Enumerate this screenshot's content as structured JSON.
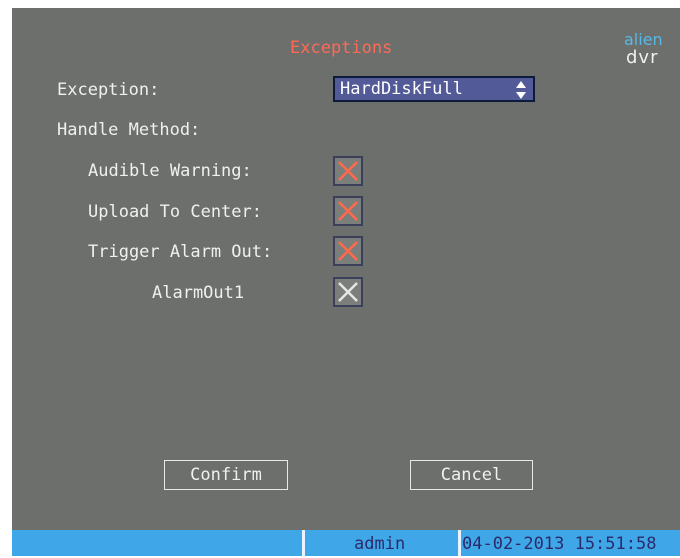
{
  "window": {
    "title": "Exceptions",
    "logo_top": "alien",
    "logo_bottom": "dvr"
  },
  "form": {
    "exception_label": "Exception:",
    "exception_value": "HardDiskFull",
    "handle_method_label": "Handle Method:",
    "options": [
      {
        "label": "Audible Warning:",
        "checked": true,
        "mark_color": "#ff6a4a"
      },
      {
        "label": "Upload To Center:",
        "checked": true,
        "mark_color": "#ff6a4a"
      },
      {
        "label": "Trigger Alarm Out:",
        "checked": true,
        "mark_color": "#ff6a4a"
      },
      {
        "label": "AlarmOut1",
        "checked": false,
        "mark_color": "#e6e6e6"
      }
    ]
  },
  "buttons": {
    "confirm": "Confirm",
    "cancel": "Cancel"
  },
  "status": {
    "user": "admin",
    "datetime": "04-02-2013 15:51:58"
  },
  "colors": {
    "panel_bg": "#6c6f6c",
    "title": "#ff6a55",
    "statusbar": "#3fa7e8",
    "select_bg": "#535a98"
  }
}
